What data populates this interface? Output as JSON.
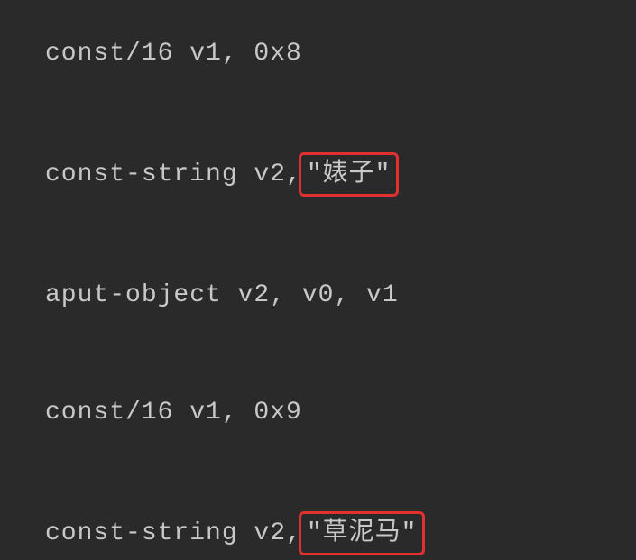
{
  "lines": [
    {
      "prefix": "const/16 v1, 0x8",
      "highlighted": null
    },
    {
      "prefix": "const-string v2,",
      "highlighted": " \"婊子\" "
    },
    {
      "prefix": "aput-object v2, v0, v1",
      "highlighted": null
    },
    {
      "prefix": "const/16 v1, 0x9",
      "highlighted": null
    },
    {
      "prefix": "const-string v2,",
      "highlighted": " \"草泥马\" "
    }
  ]
}
